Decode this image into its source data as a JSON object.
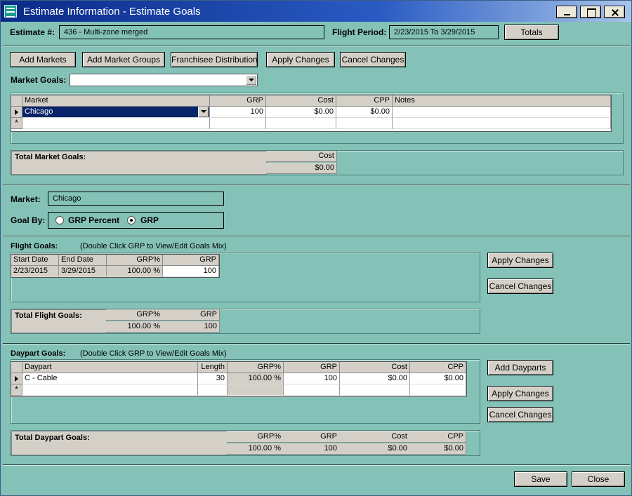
{
  "window": {
    "title": "Estimate Information - Estimate Goals"
  },
  "header": {
    "estimate_label": "Estimate #:",
    "estimate_value": "436 - Multi-zone merged",
    "flight_period_label": "Flight Period:",
    "flight_period_value": "2/23/2015 To 3/29/2015",
    "totals_button": "Totals"
  },
  "toolbar": {
    "add_markets": "Add Markets",
    "add_market_groups": "Add Market Groups",
    "franchisee_distribution": "Franchisee Distribution",
    "apply_changes": "Apply Changes",
    "cancel_changes": "Cancel Changes"
  },
  "market_goals": {
    "label": "Market Goals:",
    "combo_value": "",
    "columns": [
      "Market",
      "GRP",
      "Cost",
      "CPP",
      "Notes"
    ],
    "rows": [
      {
        "market": "Chicago",
        "grp": "100",
        "cost": "$0.00",
        "cpp": "$0.00",
        "notes": ""
      }
    ],
    "new_row_marker": "*"
  },
  "total_market_goals": {
    "label": "Total Market Goals:",
    "cost_header": "Cost",
    "cost_value": "$0.00"
  },
  "market_detail": {
    "market_label": "Market:",
    "market_value": "Chicago",
    "goal_by_label": "Goal By:",
    "option_grp_percent": "GRP Percent",
    "option_grp": "GRP",
    "selected": "GRP"
  },
  "flight_goals": {
    "label": "Flight Goals:",
    "hint": "(Double Click GRP to View/Edit Goals Mix)",
    "columns": [
      "Start Date",
      "End Date",
      "GRP%",
      "GRP"
    ],
    "rows": [
      {
        "start": "2/23/2015",
        "end": "3/29/2015",
        "grp_pct": "100.00 %",
        "grp": "100"
      }
    ],
    "apply_changes": "Apply Changes",
    "cancel_changes": "Cancel Changes"
  },
  "total_flight_goals": {
    "label": "Total Flight Goals:",
    "grp_pct_header": "GRP%",
    "grp_header": "GRP",
    "grp_pct_value": "100.00 %",
    "grp_value": "100"
  },
  "daypart_goals": {
    "label": "Daypart Goals:",
    "hint": "(Double Click GRP to View/Edit Goals Mix)",
    "columns": [
      "Daypart",
      "Length",
      "GRP%",
      "GRP",
      "Cost",
      "CPP"
    ],
    "rows": [
      {
        "daypart": "C - Cable",
        "length": "30",
        "grp_pct": "100.00 %",
        "grp": "100",
        "cost": "$0.00",
        "cpp": "$0.00"
      }
    ],
    "new_row_marker": "*",
    "add_dayparts": "Add Dayparts",
    "apply_changes": "Apply Changes",
    "cancel_changes": "Cancel Changes"
  },
  "total_daypart_goals": {
    "label": "Total Daypart Goals:",
    "grp_pct_header": "GRP%",
    "grp_header": "GRP",
    "cost_header": "Cost",
    "cpp_header": "CPP",
    "grp_pct_value": "100.00 %",
    "grp_value": "100",
    "cost_value": "$0.00",
    "cpp_value": "$0.00"
  },
  "footer": {
    "save": "Save",
    "close": "Close"
  }
}
